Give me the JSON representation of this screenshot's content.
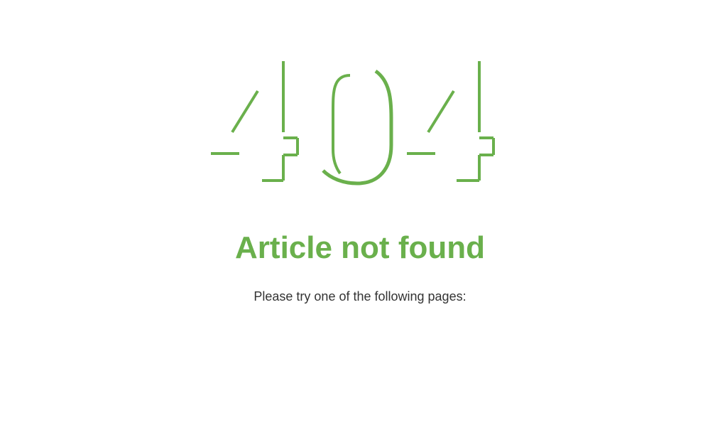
{
  "error": {
    "code": "404",
    "title": "Article not found",
    "message": "Please try one of the following pages:"
  },
  "colors": {
    "accent": "#6ab04c",
    "text": "#333333",
    "background": "#ffffff"
  }
}
